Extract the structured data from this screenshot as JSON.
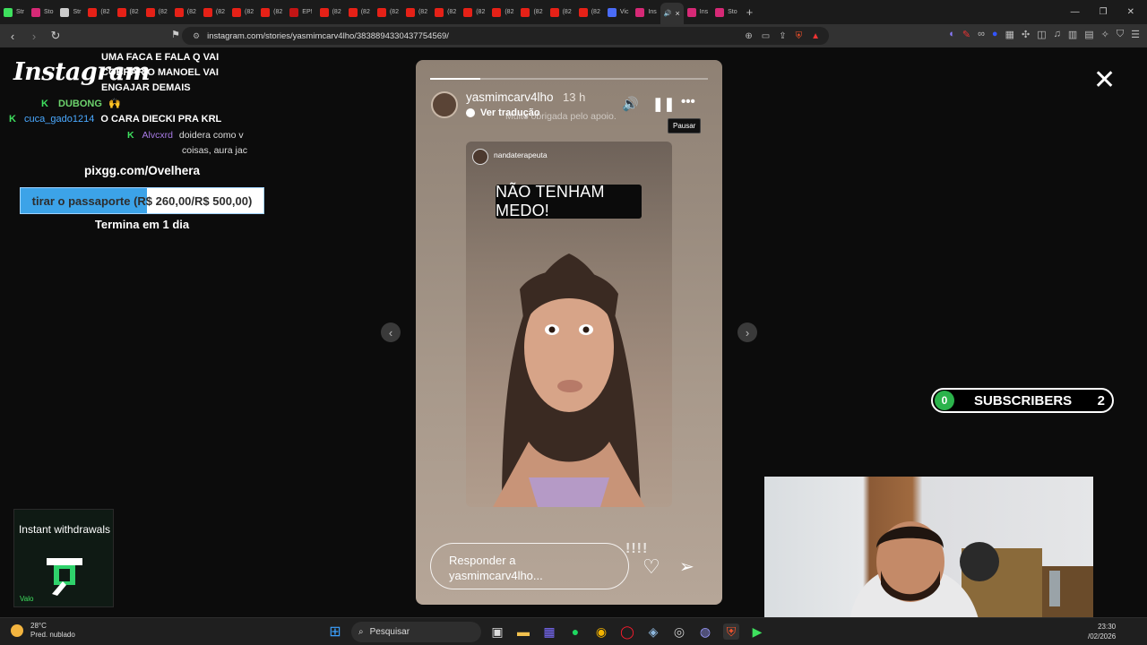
{
  "browser": {
    "tabs": [
      {
        "label": "Str",
        "color": "#3ee05e"
      },
      {
        "label": "Sto",
        "color": "#d62976"
      },
      {
        "label": "Str",
        "color": "#cccccc"
      },
      {
        "label": "(82",
        "color": "#e62117"
      },
      {
        "label": "(82",
        "color": "#e62117"
      },
      {
        "label": "(82",
        "color": "#e62117"
      },
      {
        "label": "(82",
        "color": "#e62117"
      },
      {
        "label": "(82",
        "color": "#e62117"
      },
      {
        "label": "(82",
        "color": "#e62117"
      },
      {
        "label": "(82",
        "color": "#e62117"
      },
      {
        "label": "EP!",
        "color": "#c21515"
      },
      {
        "label": "(82",
        "color": "#e62117"
      },
      {
        "label": "(82",
        "color": "#e62117"
      },
      {
        "label": "(82",
        "color": "#e62117"
      },
      {
        "label": "(82",
        "color": "#e62117"
      },
      {
        "label": "(82",
        "color": "#e62117"
      },
      {
        "label": "(82",
        "color": "#e62117"
      },
      {
        "label": "(82",
        "color": "#e62117"
      },
      {
        "label": "(82",
        "color": "#e62117"
      },
      {
        "label": "(82",
        "color": "#e62117"
      },
      {
        "label": "(82",
        "color": "#e62117"
      },
      {
        "label": "Vic",
        "color": "#4a6cf7"
      },
      {
        "label": "Ins",
        "color": "#d62976"
      }
    ],
    "active_tab_close": "×",
    "trailing_tabs": [
      {
        "label": "Ins",
        "color": "#d62976"
      },
      {
        "label": "Sto",
        "color": "#d62976"
      }
    ],
    "new_tab": "+",
    "url": "instagram.com/stories/yasmimcarv4lho/3838894330437754569/"
  },
  "overlay": {
    "logo": "Instagram",
    "chat": [
      {
        "nick": "",
        "text": "UMA FACA E FALA Q VAI"
      },
      {
        "nick": "",
        "text": "COBRAR O MANOEL VAI"
      },
      {
        "nick": "",
        "text": "ENGAJAR DEMAIS"
      },
      {
        "nick": "DUBONG",
        "text": "🙌"
      },
      {
        "nick": "cuca_gado1214",
        "text": "O CARA DIECKI PRA KRL"
      },
      {
        "nick": "Alvcxrd",
        "text": "doidera como v"
      },
      {
        "nick": "",
        "text": "coisas, aura jac"
      }
    ],
    "pix": "pixgg.com/Ovelhera",
    "goal_label": "tirar o passaporte (R$ 260,00/R$ 500,00)",
    "goal_progress": 0.52,
    "goal_end": "Termina em 1 dia",
    "subs_count_left": "0",
    "subs_label": "SUBSCRIBERS",
    "subs_count_right": "2",
    "promo_title": "Instant withdrawals",
    "promo_footer": "Valo"
  },
  "story": {
    "username": "yasmimcarv4lho",
    "time": "13 h",
    "translate": "Ver tradução",
    "ghost_text": "Muito obrigada pelo apoio.",
    "tooltip": "Pausar",
    "progress": 0.18,
    "inner_username": "nandaterapeuta",
    "inner_title": "NÃO TENHAM MEDO!",
    "reply_placeholder": "Responder a yasmimcarv4lho...",
    "bars": "!!!!"
  },
  "taskbar": {
    "temp": "28°C",
    "weather": "Pred. nublado",
    "search": "Pesquisar",
    "time": "23:30",
    "date": "/02/2026"
  }
}
